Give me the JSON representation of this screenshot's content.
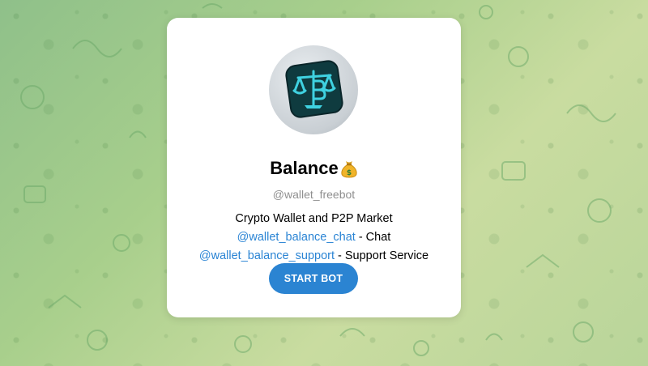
{
  "bot": {
    "name": "Balance",
    "name_emoji": "money-bag-icon",
    "username": "@wallet_freebot",
    "description_line1": "Crypto Wallet and P2P Market",
    "chat_link": "@wallet_balance_chat",
    "chat_suffix": " - Chat",
    "support_link": "@wallet_balance_support",
    "support_suffix": " - Support Service"
  },
  "actions": {
    "start_label": "START BOT"
  },
  "colors": {
    "link": "#2a84d4",
    "button": "#2b84d2",
    "avatar_tile": "#0f3b3f",
    "avatar_glyph": "#3fd1e0"
  }
}
